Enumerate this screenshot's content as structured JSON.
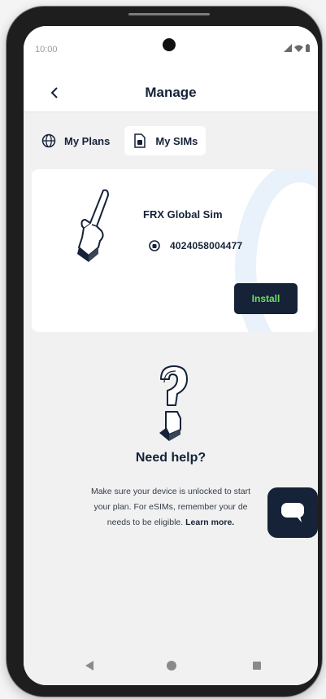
{
  "status_bar": {
    "time": "10:00"
  },
  "header": {
    "title": "Manage"
  },
  "tabs": [
    {
      "label": "My Plans",
      "icon": "globe-icon",
      "active": false
    },
    {
      "label": "My SIMs",
      "icon": "sim-card-icon",
      "active": true
    }
  ],
  "sim_card": {
    "name": "FRX Global Sim",
    "iccid": "4024058004477",
    "install_label": "Install",
    "illustration": "pointing-hand-illustration"
  },
  "help": {
    "title": "Need help?",
    "text_line1": "Make sure your device is unlocked to start",
    "text_line2": "your plan. For eSIMs, remember your de",
    "text_line3": "needs to be eligible.",
    "learn_more": "Learn more.",
    "illustration": "question-mark-illustration"
  },
  "chat": {
    "icon": "chat-bubble-icon"
  },
  "nav_bar": {
    "icons": [
      "back-triangle-icon",
      "home-circle-icon",
      "recents-square-icon"
    ]
  },
  "colors": {
    "navy": "#152238",
    "install_text": "#6ee05a",
    "background": "#f1f1f1",
    "card_bg": "#ffffff"
  }
}
